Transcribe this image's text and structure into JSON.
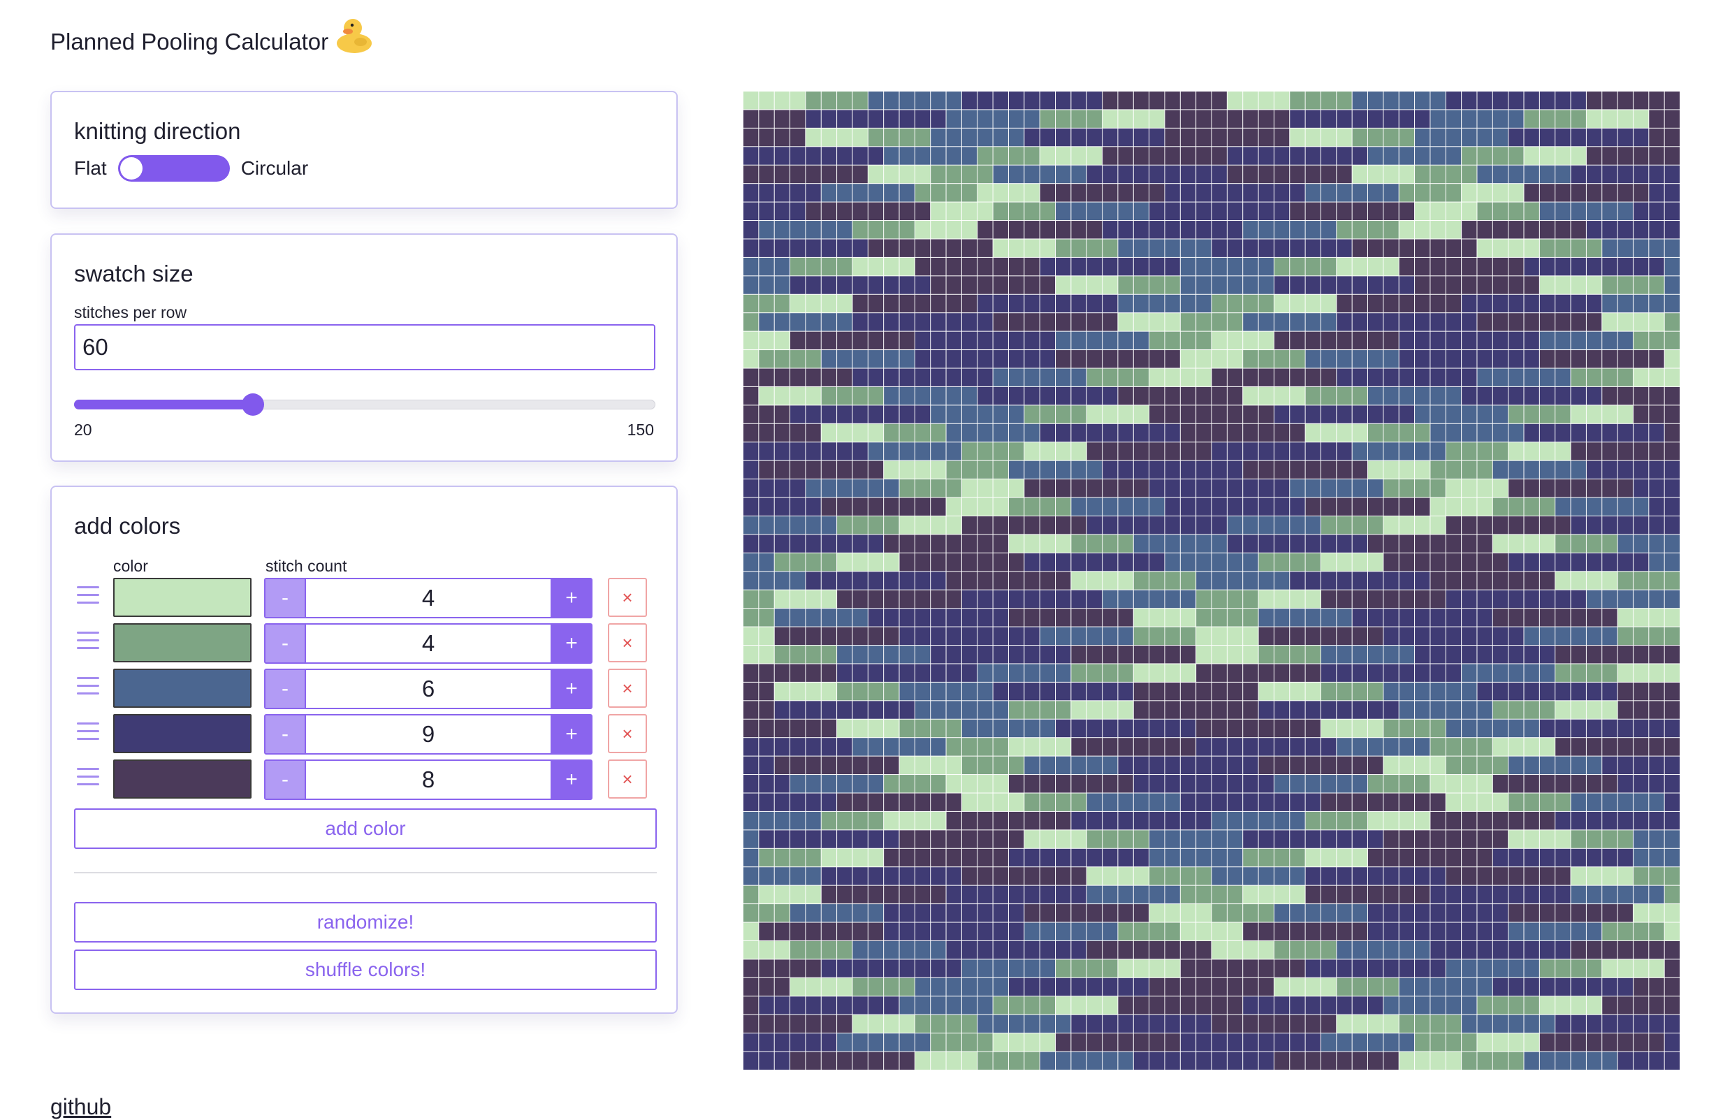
{
  "header": {
    "title": "Planned Pooling Calculator",
    "duck_icon": "rubber-duck-icon"
  },
  "knitting_direction": {
    "title": "knitting direction",
    "left_label": "Flat",
    "right_label": "Circular",
    "mode": "Flat"
  },
  "swatch_size": {
    "title": "swatch size",
    "stitches_label": "stitches per row",
    "stitches_value": "60",
    "slider_min": "20",
    "slider_max": "150",
    "slider_value": 60
  },
  "colors": {
    "title": "add colors",
    "color_header": "color",
    "count_header": "stitch count",
    "items": [
      {
        "color": "#c4e6bd",
        "count": "4"
      },
      {
        "color": "#7ea584",
        "count": "4"
      },
      {
        "color": "#4b6690",
        "count": "6"
      },
      {
        "color": "#3f3b74",
        "count": "9"
      },
      {
        "color": "#4b3a5a",
        "count": "8"
      }
    ],
    "minus_label": "-",
    "plus_label": "+",
    "remove_label": "×",
    "add_color_label": "add color",
    "randomize_label": "randomize!",
    "shuffle_label": "shuffle colors!"
  },
  "footer": {
    "github_label": "github"
  },
  "theme": {
    "accent": "#8159ec",
    "danger": "#e25555"
  }
}
